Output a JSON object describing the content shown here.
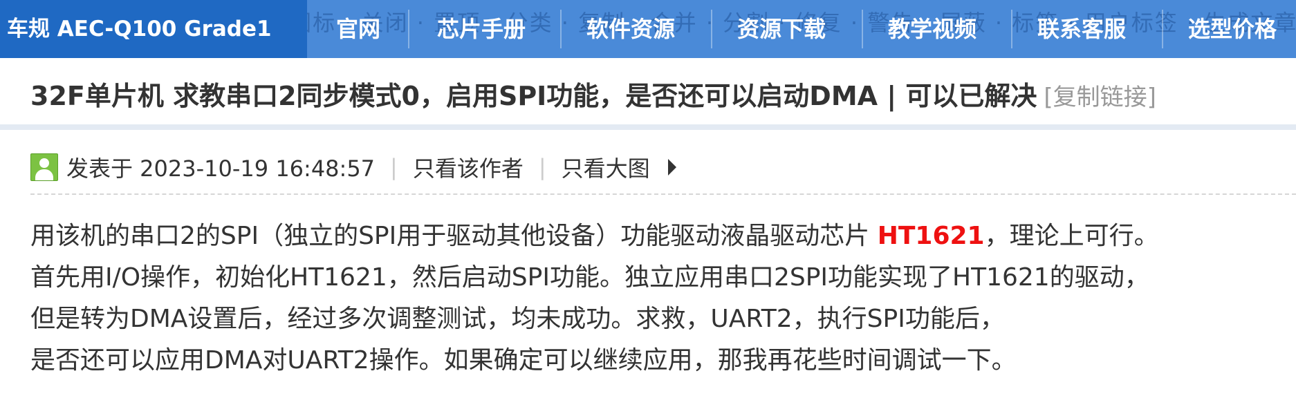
{
  "topnav": {
    "ghost_text": "牛报 · 商家 · 精华 · 图帖 · 图标 · 关闭 · 置顶 · 分类 · 复制 · 合并 · 分割 · 修复 · 警告 · 屏蔽 · 标签 · 用户标签 · 生成文章",
    "brand": "车规 AEC-Q100 Grade1",
    "items": [
      {
        "label": "官网"
      },
      {
        "label": "芯片手册"
      },
      {
        "label": "软件资源"
      },
      {
        "label": "资源下载"
      },
      {
        "label": "教学视频"
      },
      {
        "label": "联系客服"
      },
      {
        "label": "选型价格"
      }
    ]
  },
  "thread": {
    "title": "32F单片机 求教串口2同步模式0，启用SPI功能，是否还可以启动DMA | 可以已解决",
    "copy_link": "[复制链接]"
  },
  "post": {
    "posted_at": "发表于 2023-10-19 16:48:57",
    "separator": "|",
    "only_author": "只看该作者",
    "only_large_images": "只看大图",
    "lines": [
      {
        "before": "用该机的串口2的SPI（独立的SPI用于驱动其他设备）功能驱动液晶驱动芯片 ",
        "highlight": "HT1621",
        "after": "，理论上可行。"
      },
      {
        "text": "首先用I/O操作，初始化HT1621，然后启动SPI功能。独立应用串口2SPI功能实现了HT1621的驱动，"
      },
      {
        "text": "但是转为DMA设置后，经过多次调整测试，均未成功。求救，UART2，执行SPI功能后，"
      },
      {
        "text": "是否还可以应用DMA对UART2操作。如果确定可以继续应用，那我再花些时间调试一下。"
      }
    ]
  },
  "colors": {
    "nav_bg": "#4a8ad8",
    "brand_bg": "#1f69c3",
    "highlight": "#ee1111"
  }
}
